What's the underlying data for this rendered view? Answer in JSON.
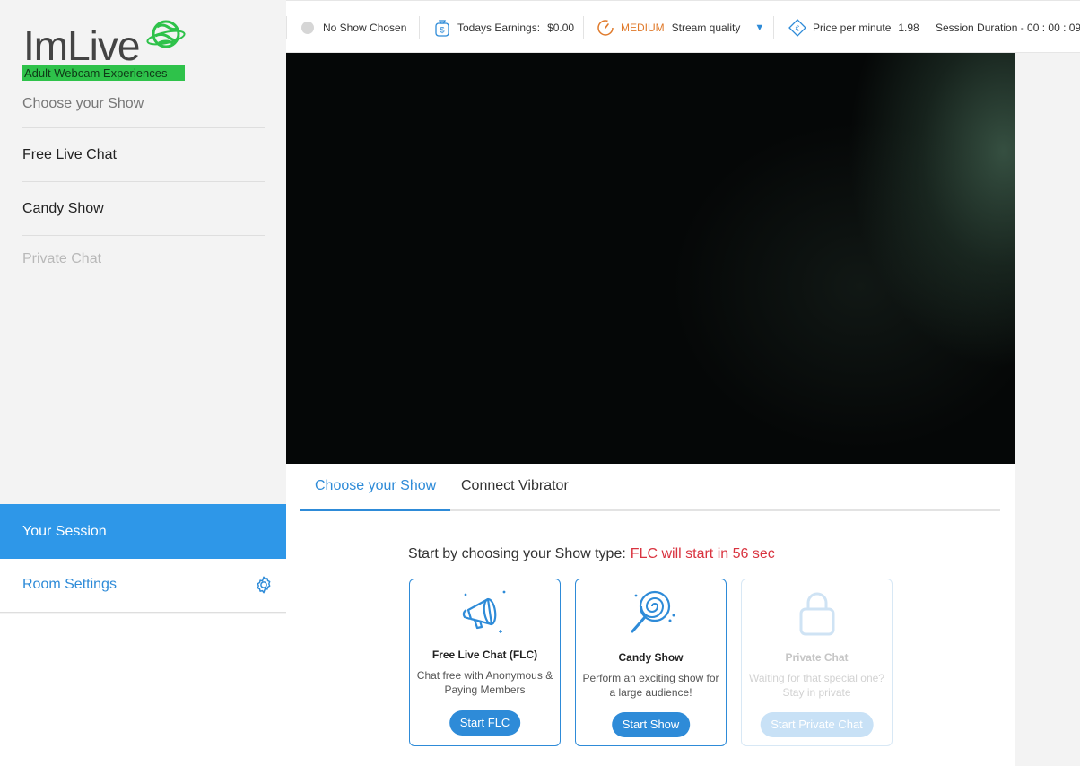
{
  "logo": {
    "wordmark": "ImLive",
    "tagline": "Adult Webcam Experiences"
  },
  "sidebar": {
    "heading": "Choose your Show",
    "items": [
      {
        "label": "Free Live Chat",
        "enabled": true
      },
      {
        "label": "Candy Show",
        "enabled": true
      },
      {
        "label": "Private Chat",
        "enabled": false
      }
    ],
    "session_label": "Your Session",
    "room_settings_label": "Room Settings"
  },
  "topbar": {
    "show_status": "No Show Chosen",
    "earnings_label": "Todays Earnings:",
    "earnings_value": "$0.00",
    "quality_level": "MEDIUM",
    "quality_label": "Stream quality",
    "price_label": "Price per minute",
    "price_value": "1.98",
    "session_duration": "Session Duration - 00 : 00 : 09"
  },
  "tabs": [
    {
      "label": "Choose your Show",
      "active": true
    },
    {
      "label": "Connect Vibrator",
      "active": false
    }
  ],
  "main": {
    "prompt": "Start by choosing your Show type:",
    "countdown": "FLC will start in 56 sec"
  },
  "cards": [
    {
      "icon": "megaphone-icon",
      "title": "Free Live Chat (FLC)",
      "desc": "Chat free with Anonymous & Paying Members",
      "button": "Start FLC",
      "enabled": true
    },
    {
      "icon": "lollipop-icon",
      "title": "Candy Show",
      "desc": "Perform an exciting show for a large audience!",
      "button": "Start Show",
      "enabled": true
    },
    {
      "icon": "lock-icon",
      "title": "Private Chat",
      "desc": "Waiting for that special one? Stay in private",
      "button": "Start Private Chat",
      "enabled": false
    }
  ],
  "colors": {
    "accent": "#2e8bd8",
    "session_bg": "#2e97e8",
    "countdown": "#d9333f",
    "quality": "#e07a2b",
    "logo_green": "#2ec24a"
  }
}
